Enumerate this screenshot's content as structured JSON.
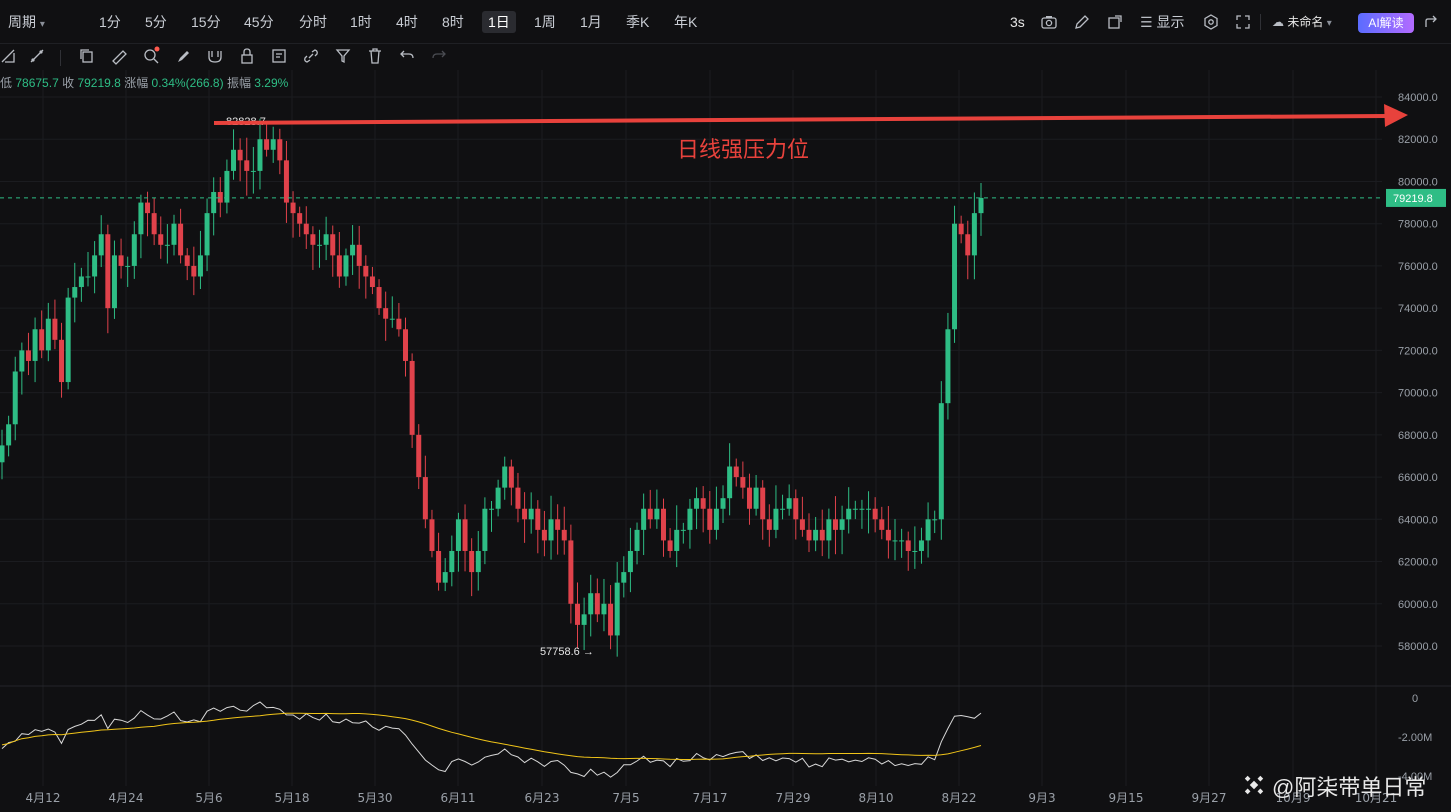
{
  "toolbar": {
    "periods": [
      "周期",
      "1分",
      "5分",
      "15分",
      "45分",
      "分时",
      "1时",
      "4时",
      "8时",
      "1日",
      "1周",
      "1月",
      "季K",
      "年K"
    ],
    "active_period": "1日",
    "refresh": "3s",
    "display_label": "显示",
    "layout_name": "未命名",
    "ai_label": "AI解读"
  },
  "ohlc": {
    "low_label": "低",
    "low_value": "78675.7",
    "close_label": "收",
    "close_value": "79219.8",
    "change_label": "涨幅",
    "change_value": "0.34%(266.8)",
    "amplitude_label": "振幅",
    "amplitude_value": "3.29%"
  },
  "annotation": {
    "text": "日线强压力位",
    "color": "#e8423c"
  },
  "watermark": "@阿柒带单日常",
  "colors": {
    "up": "#2ebd85",
    "down": "#e0424b",
    "ma": "#f0c419",
    "volume_line": "#d8d8d8"
  },
  "chart_data": {
    "type": "candlestick",
    "y_axis": {
      "min": 56000,
      "max": 85000,
      "ticks": [
        84000,
        82000,
        80000,
        78000,
        76000,
        74000,
        72000,
        70000,
        68000,
        66000,
        64000,
        62000,
        60000,
        58000
      ]
    },
    "last_price": "79219.8",
    "high_label": "82828.7",
    "low_label": "57758.6",
    "x_labels": [
      "4月12",
      "4月24",
      "5月6",
      "5月18",
      "5月30",
      "6月11",
      "6月23",
      "7月5",
      "7月17",
      "7月29",
      "8月10",
      "8月22",
      "9月3",
      "9月15",
      "9月27",
      "10月9",
      "10月21"
    ],
    "closes": [
      67500,
      68500,
      71000,
      72000,
      71500,
      73000,
      72000,
      73500,
      72500,
      70500,
      74500,
      75000,
      75500,
      75500,
      76500,
      77500,
      74000,
      76500,
      76000,
      76000,
      77500,
      79000,
      78500,
      77500,
      77000,
      77000,
      78000,
      76500,
      76000,
      75500,
      76500,
      78500,
      79500,
      79000,
      80500,
      81500,
      81000,
      80500,
      80500,
      82000,
      81500,
      82000,
      81000,
      79000,
      78500,
      78000,
      77500,
      77000,
      77000,
      77500,
      76500,
      75500,
      76500,
      77000,
      76000,
      75500,
      75000,
      74000,
      73500,
      73500,
      73000,
      71500,
      68000,
      66000,
      64000,
      62500,
      61000,
      61500,
      62500,
      64000,
      62500,
      61500,
      62500,
      64500,
      64500,
      65500,
      66500,
      65500,
      64500,
      64000,
      64500,
      63500,
      63000,
      64000,
      63500,
      63000,
      60000,
      59000,
      59500,
      60500,
      59500,
      60000,
      58500,
      61000,
      61500,
      62500,
      63500,
      64500,
      64000,
      64500,
      63000,
      62500,
      63500,
      63500,
      64500,
      65000,
      64500,
      63500,
      64500,
      65000,
      66500,
      66000,
      65500,
      64500,
      65500,
      64000,
      63500,
      64500,
      64500,
      65000,
      64000,
      63500,
      63000,
      63500,
      63000,
      64000,
      63500,
      64000,
      64500,
      64500,
      64500,
      64500,
      64000,
      63500,
      63000,
      63000,
      63000,
      62500,
      62500,
      63000,
      64000,
      64000,
      69500,
      73000,
      78000,
      77500,
      76500,
      78500,
      79219.8
    ],
    "volume_indicator": {
      "axis_labels": [
        "0",
        "-2.00M",
        "-4.00M"
      ]
    }
  }
}
